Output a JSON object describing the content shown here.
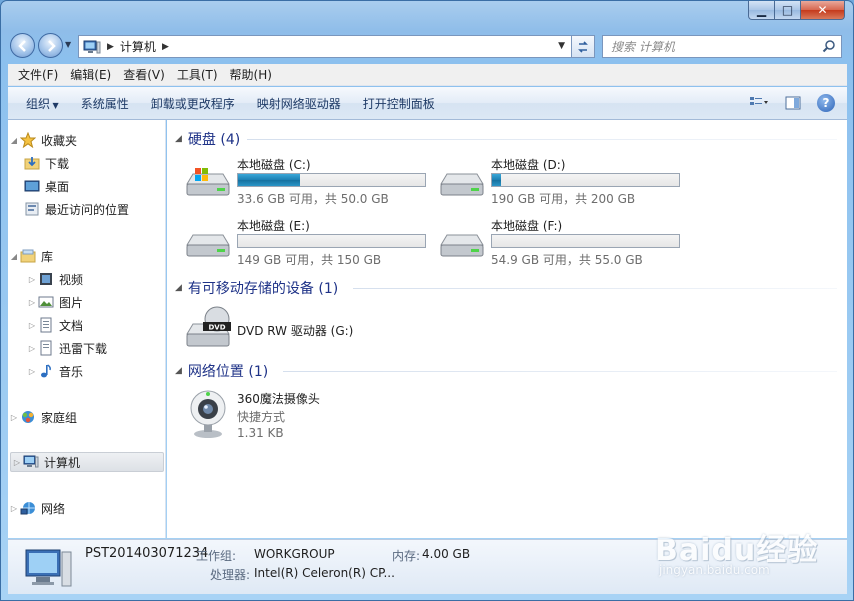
{
  "window": {
    "caption_buttons": {
      "minimize": "▁",
      "maximize": "□",
      "close": "✕"
    }
  },
  "address": {
    "path": "计算机",
    "search_placeholder": "搜索 计算机"
  },
  "menu": [
    "文件(F)",
    "编辑(E)",
    "查看(V)",
    "工具(T)",
    "帮助(H)"
  ],
  "commands": [
    "组织",
    "系统属性",
    "卸载或更改程序",
    "映射网络驱动器",
    "打开控制面板"
  ],
  "nav": {
    "favorites": {
      "label": "收藏夹",
      "items": [
        "下载",
        "桌面",
        "最近访问的位置"
      ]
    },
    "library": {
      "label": "库",
      "items": [
        "视频",
        "图片",
        "文档",
        "迅雷下载",
        "音乐"
      ]
    },
    "homegroup": "家庭组",
    "computer": "计算机",
    "network": "网络"
  },
  "groups": {
    "hard_disks": "硬盘 (4)",
    "removable": "有可移动存储的设备 (1)",
    "network_locations": "网络位置 (1)"
  },
  "drives": [
    {
      "name": "本地磁盘 (C:)",
      "free_text": "33.6 GB 可用，共 50.0 GB",
      "used_fraction": 0.33
    },
    {
      "name": "本地磁盘 (D:)",
      "free_text": "190 GB 可用，共 200 GB",
      "used_fraction": 0.05
    },
    {
      "name": "本地磁盘 (E:)",
      "free_text": "149 GB 可用，共 150 GB",
      "used_fraction": 0.0
    },
    {
      "name": "本地磁盘 (F:)",
      "free_text": "54.9 GB 可用，共 55.0 GB",
      "used_fraction": 0.0
    }
  ],
  "dvd": {
    "name": "DVD RW 驱动器 (G:)",
    "badge": "DVD"
  },
  "network_item": {
    "name": "360魔法摄像头",
    "type": "快捷方式",
    "size": "1.31 KB"
  },
  "details": {
    "computer_name": "PST201403071234",
    "workgroup_label": "工作组:",
    "workgroup_value": "WORKGROUP",
    "memory_label": "内存:",
    "memory_value": "4.00 GB",
    "cpu_label": "处理器:",
    "cpu_value": "Intel(R) Celeron(R) CP..."
  },
  "watermark": {
    "main": "Baidu经验",
    "sub": "jingyan.baidu.com"
  },
  "colors": {
    "accent_blue": "#1e3287",
    "drive_bar": "#1c7fb3",
    "frame": "#8fbde9"
  }
}
